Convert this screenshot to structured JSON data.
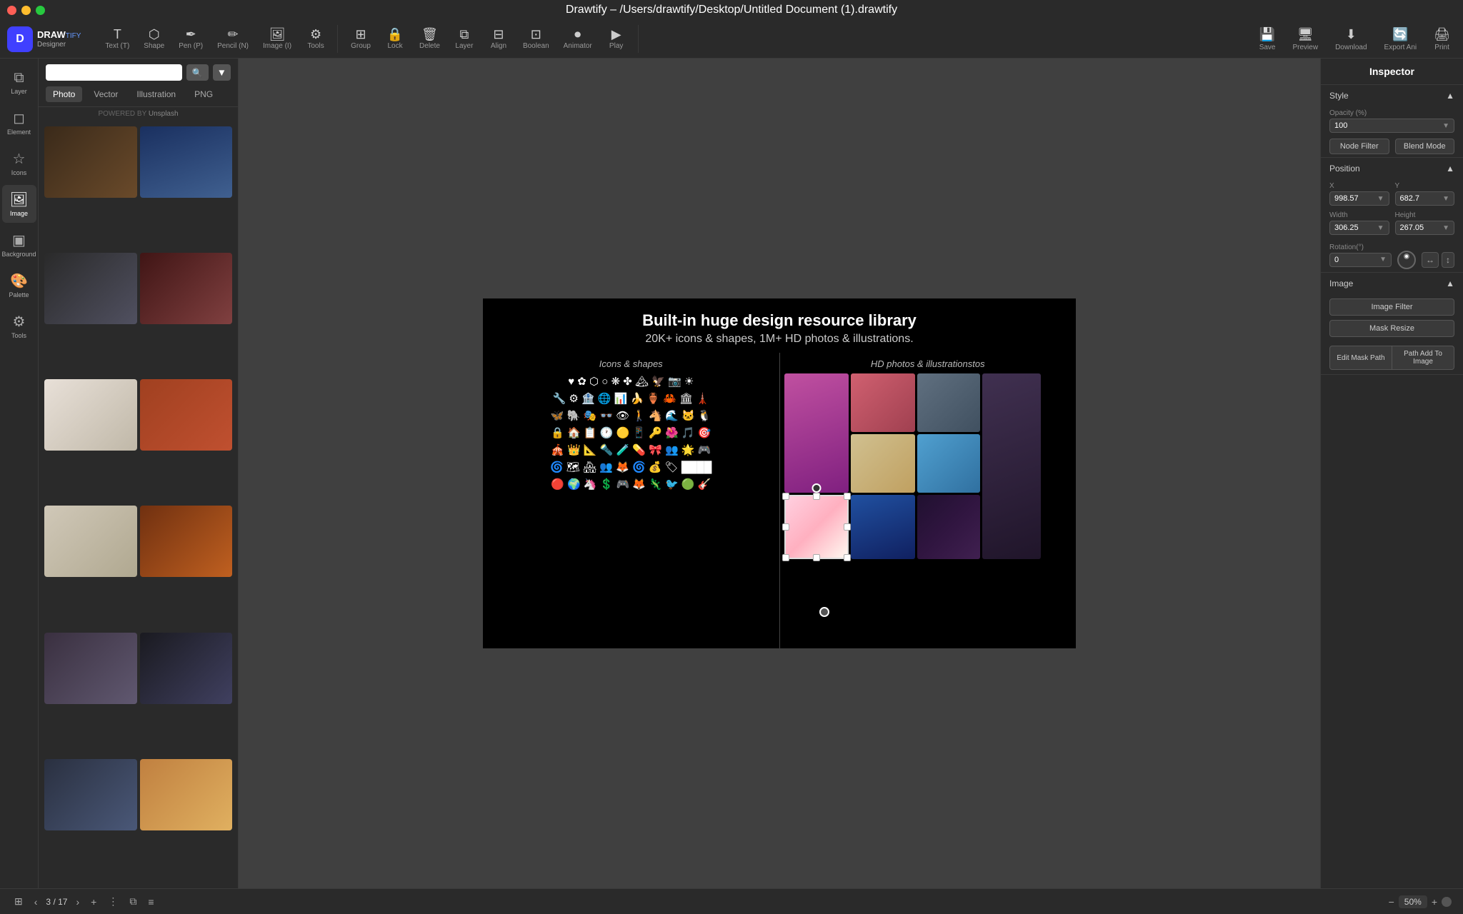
{
  "window": {
    "title": "Drawtify – /Users/drawtify/Desktop/Untitled Document (1).drawtify"
  },
  "toolbar": {
    "tools": [
      {
        "id": "text",
        "icon": "T",
        "label": "Text (T)"
      },
      {
        "id": "shape",
        "icon": "⬡",
        "label": "Shape"
      },
      {
        "id": "pen",
        "icon": "✒",
        "label": "Pen (P)"
      },
      {
        "id": "pencil",
        "icon": "✏",
        "label": "Pencil (N)"
      },
      {
        "id": "image",
        "icon": "🖼",
        "label": "Image (I)"
      },
      {
        "id": "tools",
        "icon": "⚙",
        "label": "Tools"
      }
    ],
    "actions": [
      {
        "id": "group",
        "icon": "⊞",
        "label": "Group"
      },
      {
        "id": "lock",
        "icon": "🔒",
        "label": "Lock"
      },
      {
        "id": "delete",
        "icon": "🗑",
        "label": "Delete"
      },
      {
        "id": "layer",
        "icon": "⧉",
        "label": "Layer"
      },
      {
        "id": "align",
        "icon": "⊟",
        "label": "Align"
      },
      {
        "id": "boolean",
        "icon": "⊡",
        "label": "Boolean"
      },
      {
        "id": "animator",
        "icon": "⏺",
        "label": "Animator"
      },
      {
        "id": "play",
        "icon": "▶",
        "label": "Play"
      }
    ],
    "right_actions": [
      {
        "id": "save",
        "icon": "💾",
        "label": "Save"
      },
      {
        "id": "preview",
        "icon": "🖥",
        "label": "Preview"
      },
      {
        "id": "download",
        "icon": "⬇",
        "label": "Download"
      },
      {
        "id": "export-ani",
        "icon": "🔄",
        "label": "Export Ani"
      },
      {
        "id": "print",
        "icon": "🖨",
        "label": "Print"
      }
    ]
  },
  "left_sidebar": {
    "items": [
      {
        "id": "layer",
        "icon": "⧉",
        "label": "Layer"
      },
      {
        "id": "element",
        "icon": "◻",
        "label": "Element"
      },
      {
        "id": "icons",
        "icon": "☆",
        "label": "Icons"
      },
      {
        "id": "image",
        "icon": "🖼",
        "label": "Image"
      },
      {
        "id": "background",
        "icon": "▣",
        "label": "Background"
      },
      {
        "id": "palette",
        "icon": "🎨",
        "label": "Palette"
      },
      {
        "id": "tools",
        "icon": "⚙",
        "label": "Tools"
      }
    ]
  },
  "left_panel": {
    "search_placeholder": "",
    "tabs": [
      "Photo",
      "Vector",
      "Illustration",
      "PNG"
    ],
    "active_tab": "Photo",
    "powered_by": "POWERED BY Unsplash",
    "photos": [
      {
        "id": 1,
        "class": "p1"
      },
      {
        "id": 2,
        "class": "p2"
      },
      {
        "id": 3,
        "class": "p3"
      },
      {
        "id": 4,
        "class": "p4"
      },
      {
        "id": 5,
        "class": "p5"
      },
      {
        "id": 6,
        "class": "p6"
      },
      {
        "id": 7,
        "class": "p7"
      },
      {
        "id": 8,
        "class": "p8"
      },
      {
        "id": 9,
        "class": "p9"
      },
      {
        "id": 10,
        "class": "p10"
      },
      {
        "id": 11,
        "class": "p11"
      },
      {
        "id": 12,
        "class": "p12"
      }
    ]
  },
  "canvas": {
    "heading": "Built-in huge design resource library",
    "subheading": "20K+ icons & shapes, 1M+ HD photos & illustrations.",
    "icons_section_title": "Icons & shapes",
    "photos_section_title": "HD photos & illustrationstos"
  },
  "bottom_bar": {
    "page_current": "3",
    "page_total": "17",
    "zoom_level": "50%"
  },
  "inspector": {
    "title": "Inspector",
    "style_section": "Style",
    "opacity_label": "Opacity (%)",
    "opacity_value": "100",
    "node_filter_label": "Node Filter",
    "blend_mode_label": "Blend Mode",
    "position_section": "Position",
    "x_label": "X",
    "x_value": "998.57",
    "y_label": "Y",
    "y_value": "682.7",
    "width_label": "Width",
    "width_value": "306.25",
    "height_label": "Height",
    "height_value": "267.05",
    "rotation_label": "Rotation(°)",
    "rotation_value": "0",
    "image_section": "Image",
    "image_filter_label": "Image Filter",
    "mask_resize_label": "Mask Resize",
    "edit_mask_path_label": "Edit Mask Path",
    "path_add_label": "Path Add To Image"
  }
}
